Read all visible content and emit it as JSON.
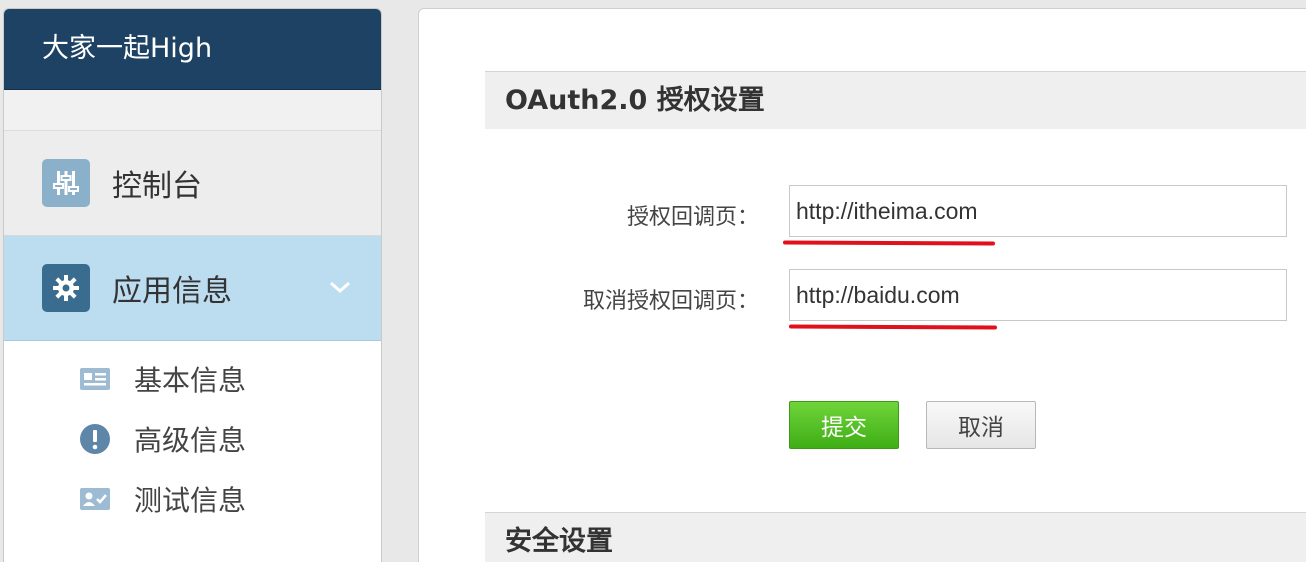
{
  "sidebar": {
    "app_title": "大家一起High",
    "nav": [
      {
        "label": "控制台",
        "icon": "sliders-icon"
      },
      {
        "label": "应用信息",
        "icon": "gear-icon",
        "expanded": true
      }
    ],
    "sub_items": [
      {
        "label": "基本信息",
        "icon": "id-card-icon"
      },
      {
        "label": "高级信息",
        "icon": "exclamation-icon"
      },
      {
        "label": "测试信息",
        "icon": "user-check-icon"
      }
    ]
  },
  "main": {
    "oauth_section": {
      "title": "OAuth2.0 授权设置",
      "callback_label": "授权回调页：",
      "callback_value": "http://itheima.com",
      "cancel_callback_label": "取消授权回调页：",
      "cancel_callback_value": "http://baidu.com",
      "submit_label": "提交",
      "cancel_label": "取消"
    },
    "security_section": {
      "title": "安全设置"
    }
  },
  "colors": {
    "header_bg": "#1e4264",
    "active_nav_bg": "#bcdcf0",
    "submit_green": "#4cbc1f",
    "annotation_red": "#e0101c"
  }
}
